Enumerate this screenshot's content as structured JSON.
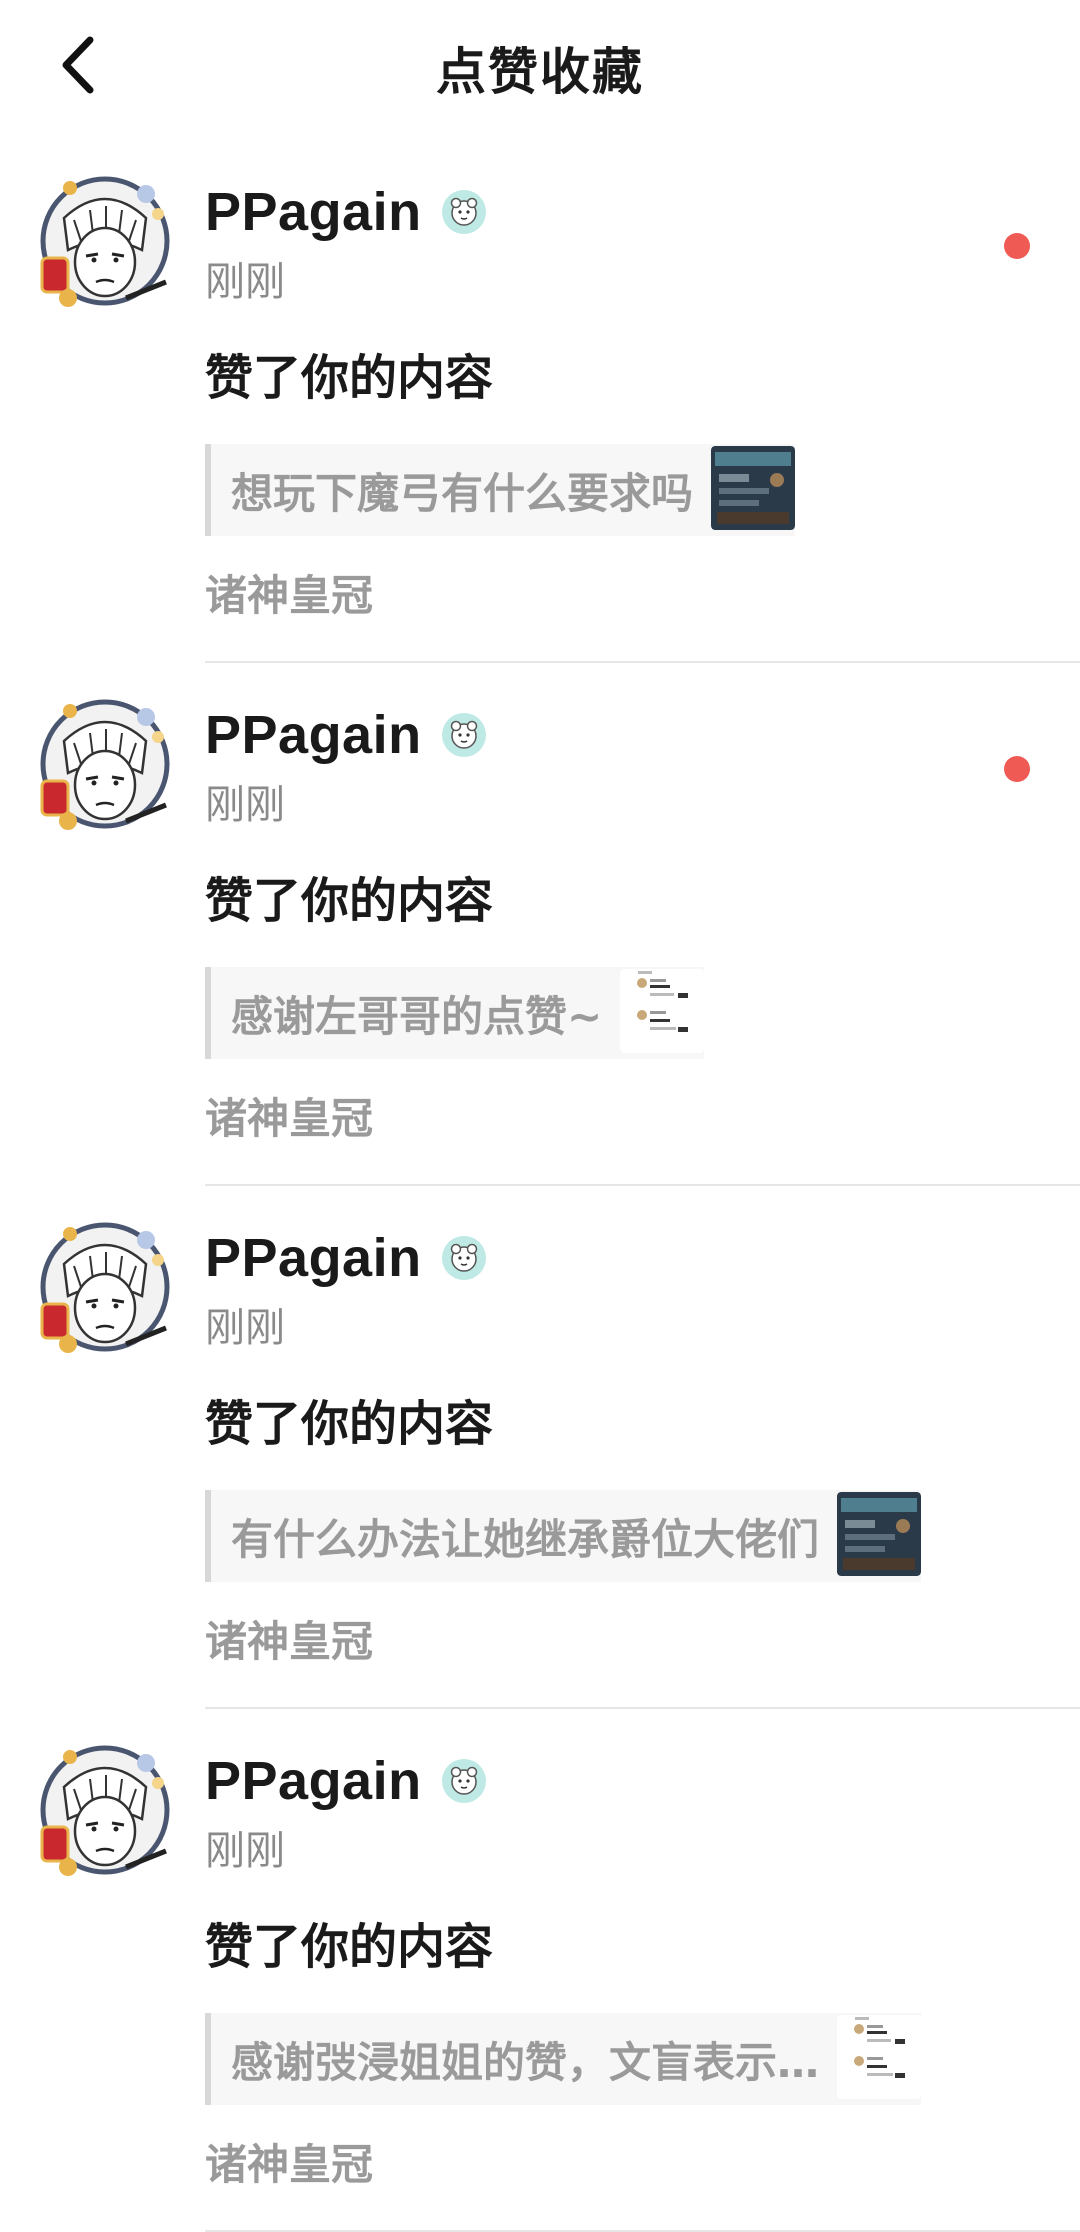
{
  "header": {
    "title": "点赞收藏",
    "back_icon": "chevron-left-icon"
  },
  "colors": {
    "unread_dot": "#f05a55",
    "badge_bg": "#bfe9e4",
    "muted_text": "#9a9a9a"
  },
  "items": [
    {
      "name": "PPagain",
      "time": "刚刚",
      "action": "赞了你的内容",
      "quote": "想玩下魔弓有什么要求吗",
      "source": "诸神皇冠",
      "unread": true,
      "thumb": "game-screenshot-dark"
    },
    {
      "name": "PPagain",
      "time": "刚刚",
      "action": "赞了你的内容",
      "quote": "感谢左哥哥的点赞~",
      "source": "诸神皇冠",
      "unread": true,
      "thumb": "notification-screenshot-light"
    },
    {
      "name": "PPagain",
      "time": "刚刚",
      "action": "赞了你的内容",
      "quote": "有什么办法让她继承爵位大佬们",
      "source": "诸神皇冠",
      "unread": false,
      "thumb": "game-screenshot-dark"
    },
    {
      "name": "PPagain",
      "time": "刚刚",
      "action": "赞了你的内容",
      "quote": "感谢弢浸姐姐的赞，文盲表示…",
      "source": "诸神皇冠",
      "unread": false,
      "thumb": "notification-screenshot-light"
    }
  ]
}
